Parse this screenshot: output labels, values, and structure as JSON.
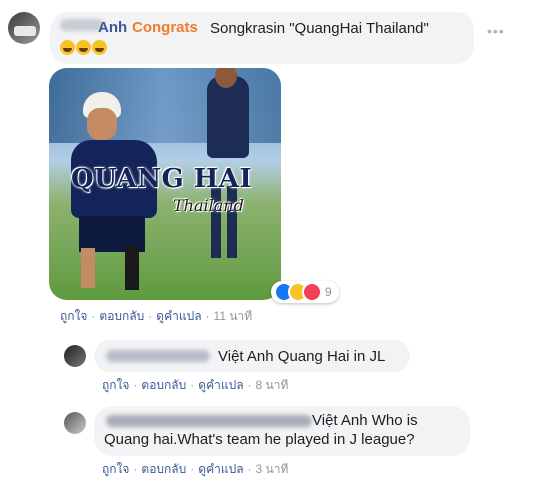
{
  "colors": {
    "link": "#385898",
    "tag": "#f07c2c",
    "bubble": "#f2f3f5",
    "muted": "#90949c"
  },
  "main_comment": {
    "author_partial": "Anh",
    "tag": "Congrats",
    "text": "Songkrasin \"QuangHai Thailand\"",
    "emoji_icons": [
      "rolling-laughing-emoji",
      "rolling-laughing-emoji",
      "rolling-laughing-emoji"
    ],
    "image": {
      "title_line1": "QUANG HAI",
      "title_line2": "Thailand"
    },
    "reactions": {
      "icons": [
        "like-icon",
        "haha-icon",
        "love-icon"
      ],
      "count": "9"
    },
    "actions": {
      "like": "ถูกใจ",
      "reply": "ตอบกลับ",
      "translate": "ดูคำแปล",
      "time": "11 นาที"
    }
  },
  "replies": [
    {
      "text": "Việt Anh Quang Hai in JL",
      "actions": {
        "like": "ถูกใจ",
        "reply": "ตอบกลับ",
        "translate": "ดูคำแปล",
        "time": "8 นาที"
      }
    },
    {
      "text_line1": "Việt Anh Who is",
      "text_line2": "Quang hai.What's team he played in J league?",
      "actions": {
        "like": "ถูกใจ",
        "reply": "ตอบกลับ",
        "translate": "ดูคำแปล",
        "time": "3 นาที"
      }
    }
  ]
}
